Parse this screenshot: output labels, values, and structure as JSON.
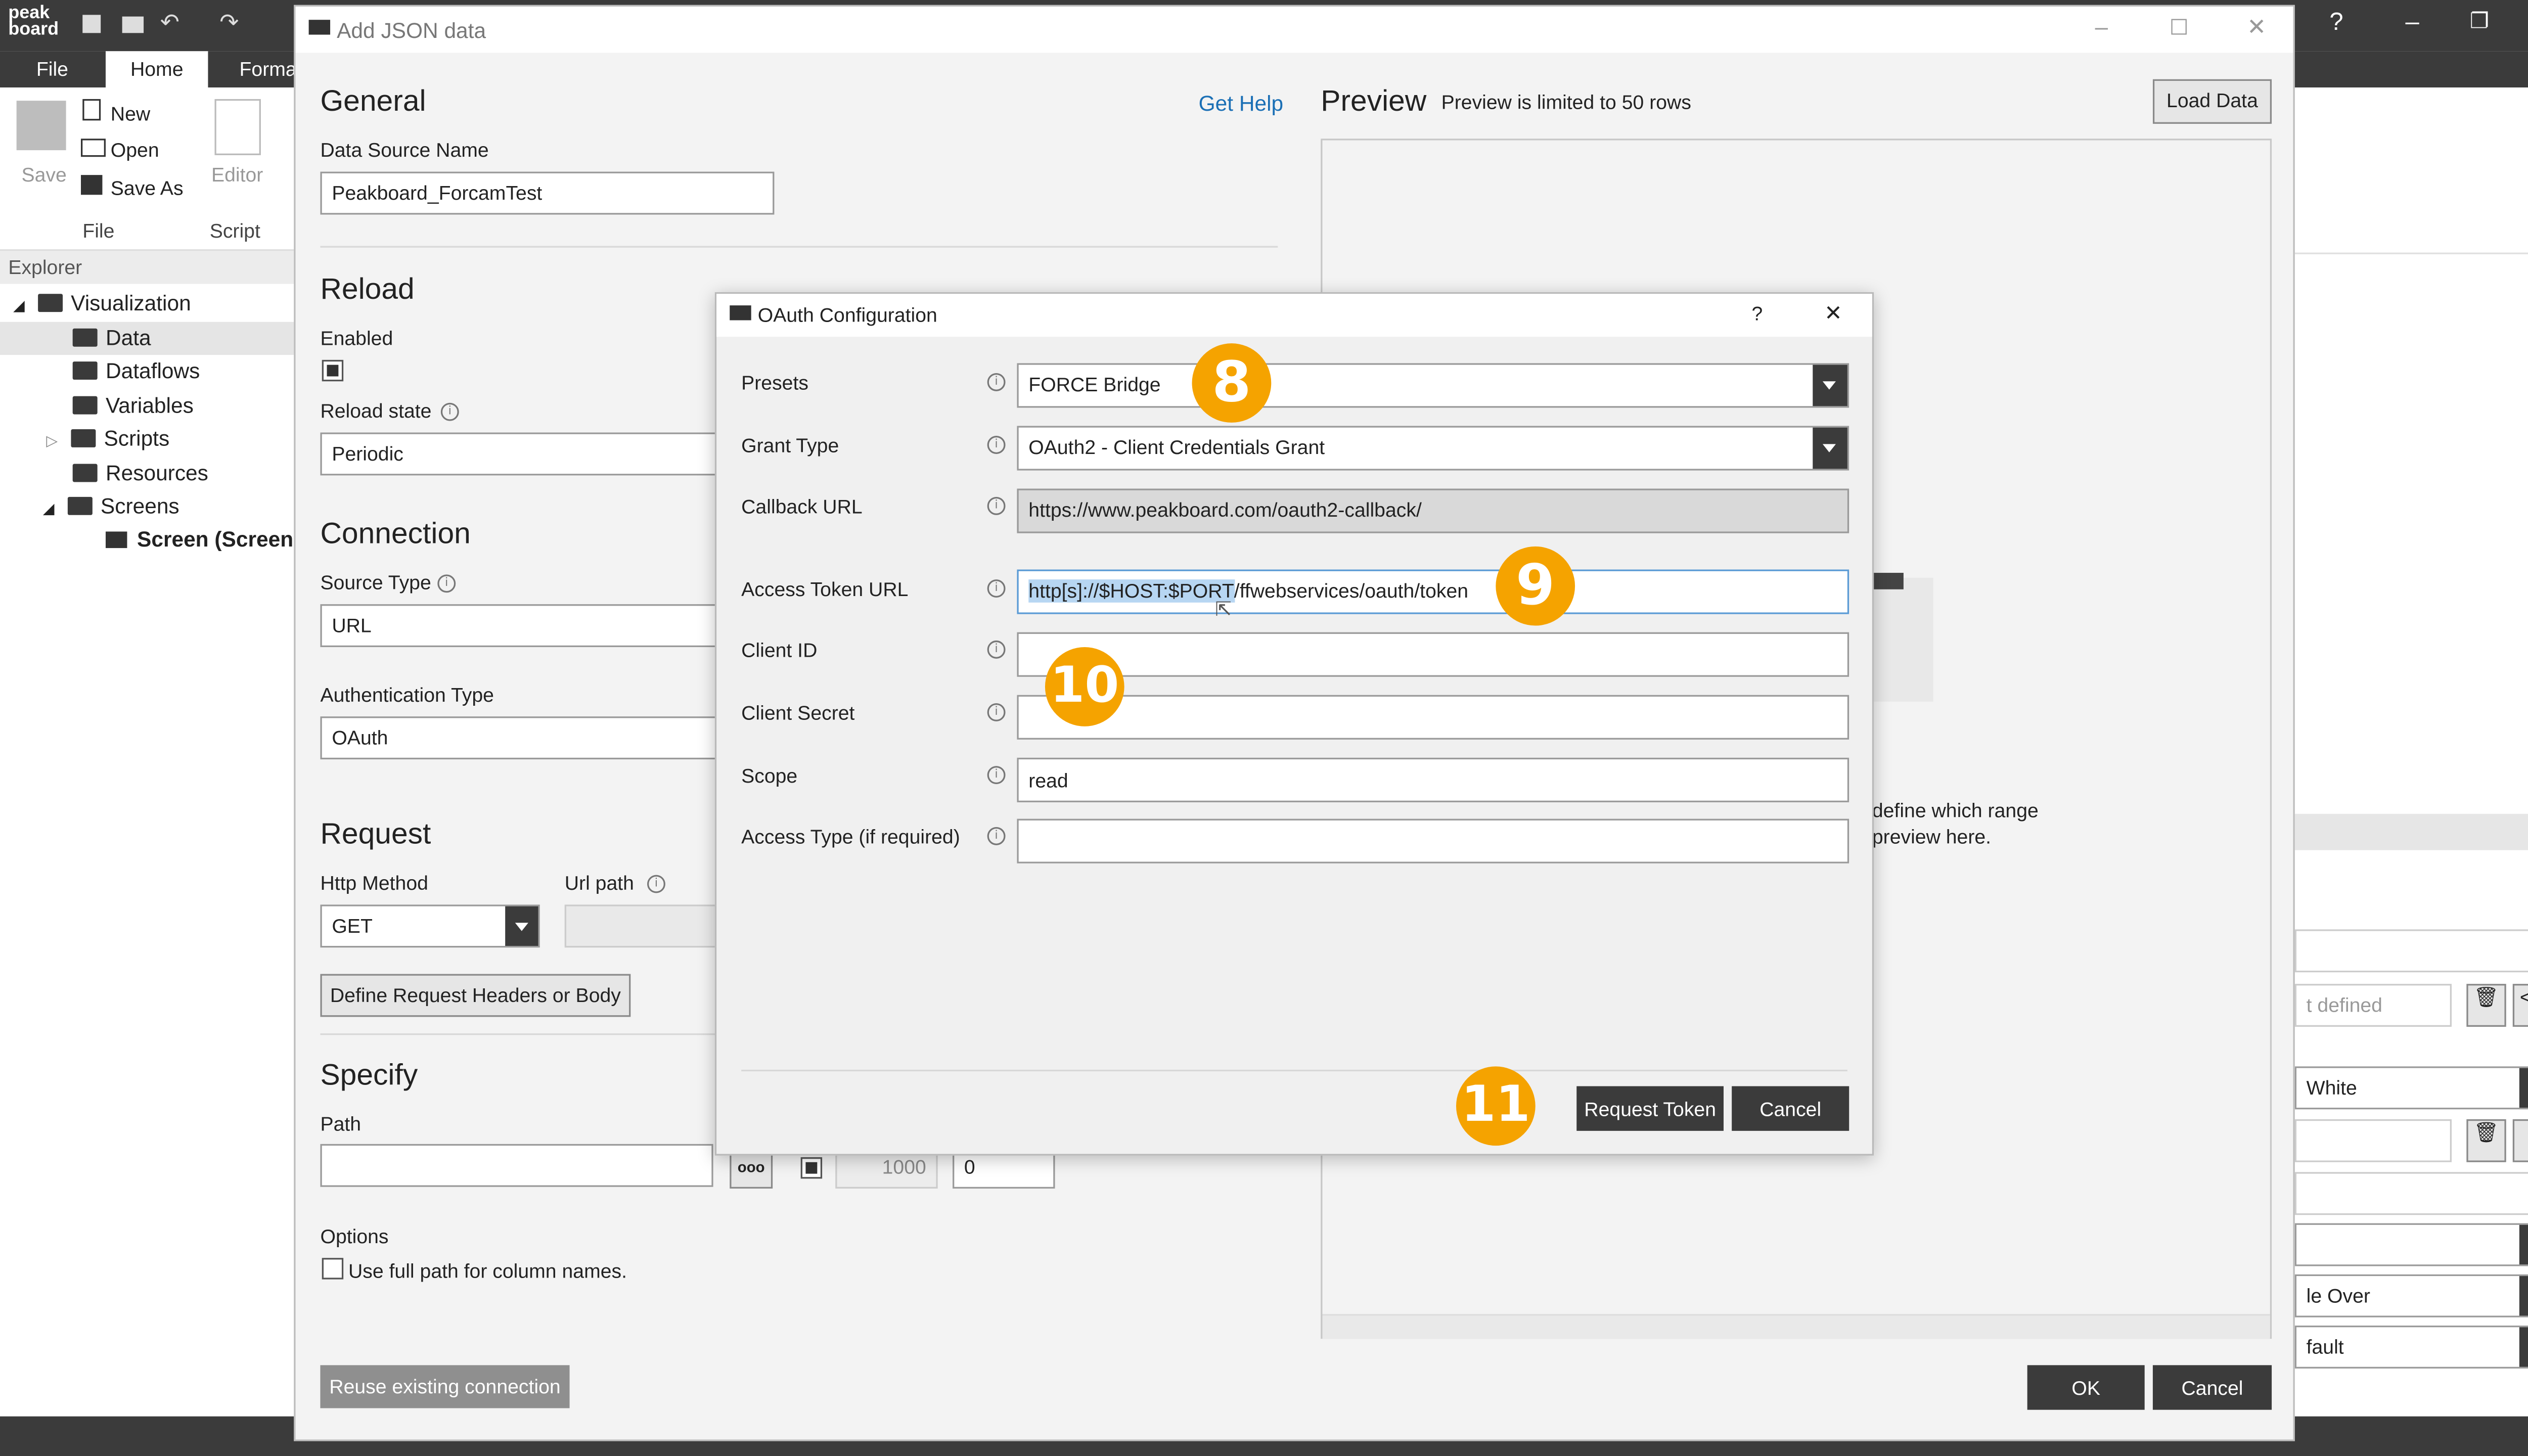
{
  "app": {
    "logo_top": "peak",
    "logo_bottom": "board",
    "ribbon_tabs": [
      "File",
      "Home",
      "Forma"
    ],
    "ribbon_buttons": {
      "save": "Save",
      "new": "New",
      "open": "Open",
      "save_as": "Save As",
      "editor": "Editor",
      "group_file": "File",
      "group_script": "Script"
    },
    "explorer": {
      "header": "Explorer",
      "items": [
        {
          "label": "Visualization"
        },
        {
          "label": "Data"
        },
        {
          "label": "Dataflows"
        },
        {
          "label": "Variables"
        },
        {
          "label": "Scripts"
        },
        {
          "label": "Resources"
        },
        {
          "label": "Screens"
        },
        {
          "label": "Screen (Screen"
        }
      ]
    },
    "right_panel": {
      "not_defined": "t defined",
      "white": "White",
      "fade_over": "le Over",
      "default": "fault"
    },
    "window_controls": {
      "help": "?",
      "minimize": "–",
      "restore": "❐",
      "close": "✕"
    }
  },
  "json_dialog": {
    "title": "Add JSON data",
    "get_help": "Get Help",
    "general": {
      "heading": "General",
      "name_label": "Data Source Name",
      "name_value": "Peakboard_ForcamTest"
    },
    "reload": {
      "heading": "Reload",
      "enabled_label": "Enabled",
      "state_label": "Reload state",
      "state_value": "Periodic"
    },
    "connection": {
      "heading": "Connection",
      "source_type_label": "Source Type",
      "source_type_value": "URL",
      "auth_type_label": "Authentication Type",
      "auth_type_value": "OAuth"
    },
    "request": {
      "heading": "Request",
      "method_label": "Http Method",
      "method_value": "GET",
      "url_path_label": "Url path",
      "headers_button": "Define Request Headers or Body"
    },
    "specify": {
      "heading": "Specify",
      "path_label": "Path",
      "path_value": "",
      "rows_value": "1000",
      "offset_value": "0",
      "ellipsis_button": "ooo"
    },
    "options": {
      "heading": "Options",
      "full_path_label": "Use full path for column names."
    },
    "reuse_button": "Reuse existing connection",
    "preview": {
      "heading": "Preview",
      "note": "Preview is limited to 50 rows",
      "load_button": "Load Data",
      "hint_line1": "define which range",
      "hint_line2": "preview here."
    },
    "ok_button": "OK",
    "cancel_button": "Cancel"
  },
  "oauth_dialog": {
    "title": "OAuth Configuration",
    "help": "?",
    "close": "✕",
    "fields": {
      "presets_label": "Presets",
      "presets_value": "FORCE Bridge",
      "grant_label": "Grant Type",
      "grant_value": "OAuth2 - Client Credentials Grant",
      "callback_label": "Callback URL",
      "callback_value": "https://www.peakboard.com/oauth2-callback/",
      "token_url_label": "Access Token URL",
      "token_url_selected": "http[s]://$HOST:$PORT",
      "token_url_rest": "/ffwebservices/oauth/token",
      "client_id_label": "Client ID",
      "client_id_value": "",
      "client_secret_label": "Client Secret",
      "client_secret_value": "",
      "scope_label": "Scope",
      "scope_value": "read",
      "access_type_label": "Access Type (if required)",
      "access_type_value": ""
    },
    "request_token_button": "Request Token",
    "cancel_button": "Cancel"
  },
  "badges": [
    "8",
    "9",
    "10",
    "11"
  ],
  "colors": {
    "dark_chrome": "#3b3b3b",
    "badge": "#f5a300",
    "link": "#1a6fb5",
    "selection": "#b7d6f2"
  }
}
